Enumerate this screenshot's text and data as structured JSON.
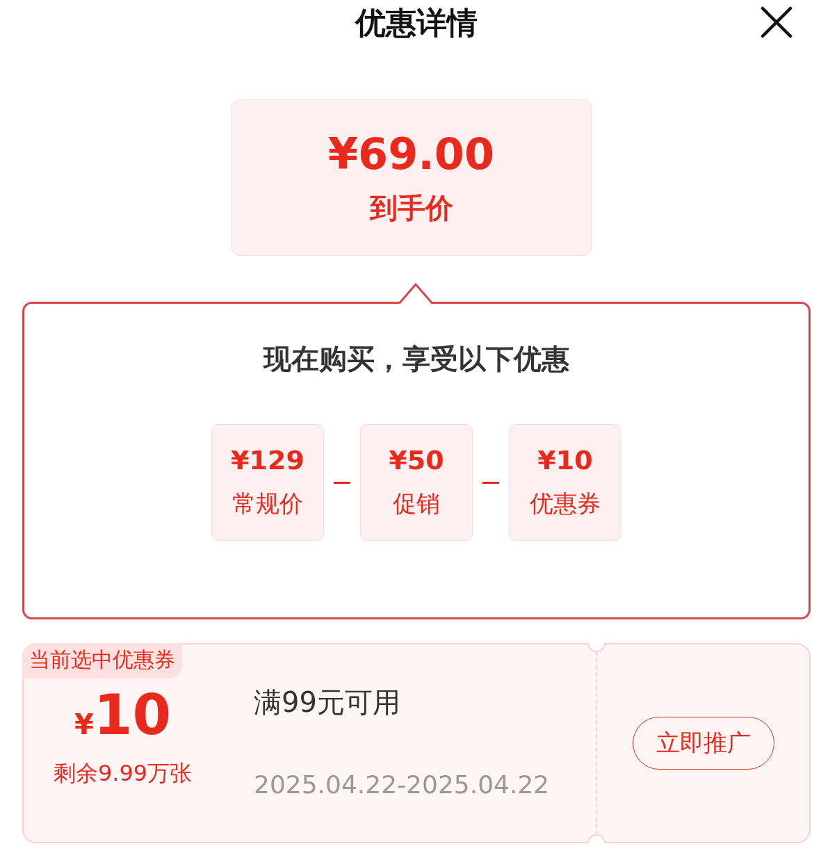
{
  "title": "优惠详情",
  "final_price": {
    "amount": "¥69.00",
    "label": "到手价"
  },
  "breakdown": {
    "heading": "现在购买，享受以下优惠",
    "items": [
      {
        "amount": "¥129",
        "label": "常规价"
      },
      {
        "amount": "¥50",
        "label": "促销"
      },
      {
        "amount": "¥10",
        "label": "优惠券"
      }
    ]
  },
  "coupon": {
    "tag": "当前选中优惠券",
    "currency": "¥",
    "value": "10",
    "remaining": "剩余9.99万张",
    "condition": "满99元可用",
    "validity": "2025.04.22-2025.04.22",
    "button": "立即推广"
  }
}
